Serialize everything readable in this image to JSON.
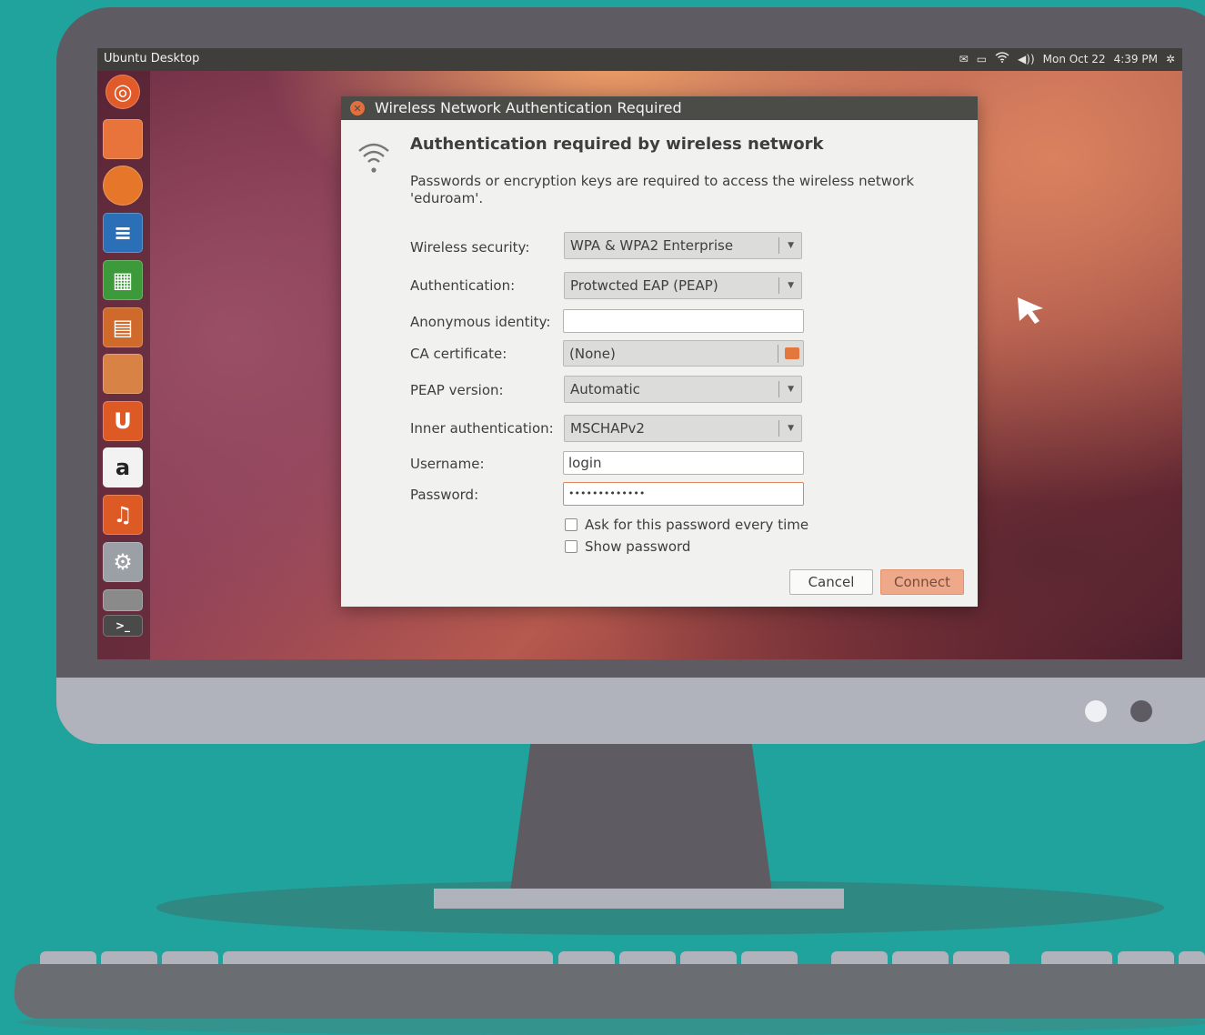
{
  "topbar": {
    "title": "Ubuntu Desktop",
    "date": "Mon Oct 22",
    "time": "4:39 PM",
    "tray_icons": [
      "mail-icon",
      "battery-icon",
      "wifi-icon",
      "volume-icon",
      "settings-gear-icon"
    ]
  },
  "launcher": {
    "items": [
      {
        "name": "ubuntu-dash-icon",
        "color": "#e05a2a"
      },
      {
        "name": "files-folder-icon",
        "color": "#e8743b"
      },
      {
        "name": "firefox-icon",
        "color": "#e6762a"
      },
      {
        "name": "libreoffice-writer-icon",
        "color": "#2b6fb6"
      },
      {
        "name": "libreoffice-calc-icon",
        "color": "#3d9a3a"
      },
      {
        "name": "libreoffice-impress-icon",
        "color": "#d06a2a"
      },
      {
        "name": "software-center-icon",
        "color": "#d88345"
      },
      {
        "name": "ubuntu-one-icon",
        "color": "#dd5a24"
      },
      {
        "name": "amazon-icon",
        "color": "#f2f2f2"
      },
      {
        "name": "ubuntu-one-music-icon",
        "color": "#dd5a24"
      },
      {
        "name": "system-settings-icon",
        "color": "#9aa0a6"
      },
      {
        "name": "workspace-switcher-icon",
        "color": "#8a8a8a"
      },
      {
        "name": "terminal-icon",
        "color": "#4a4a4a"
      }
    ]
  },
  "dialog": {
    "title": "Wireless Network Authentication Required",
    "heading": "Authentication required by wireless network",
    "message": "Passwords or encryption keys are required to access the wireless network 'eduroam'.",
    "fields": {
      "wireless_security": {
        "label": "Wireless security:",
        "value": "WPA & WPA2 Enterprise"
      },
      "authentication": {
        "label": "Authentication:",
        "value": "Protwcted EAP (PEAP)"
      },
      "anonymous_identity": {
        "label": "Anonymous identity:",
        "value": ""
      },
      "ca_certificate": {
        "label": "CA certificate:",
        "value": "(None)"
      },
      "peap_version": {
        "label": "PEAP version:",
        "value": "Automatic"
      },
      "inner_authentication": {
        "label": "Inner authentication:",
        "value": "MSCHAPv2"
      },
      "username": {
        "label": "Username:",
        "value": "login"
      },
      "password": {
        "label": "Password:",
        "value": "•••••••••••••"
      }
    },
    "checkboxes": {
      "ask_password": {
        "label": "Ask for this password every time",
        "checked": false
      },
      "show_password": {
        "label": "Show password",
        "checked": false
      }
    },
    "buttons": {
      "cancel": "Cancel",
      "connect": "Connect"
    }
  },
  "colors": {
    "background": "#1fa39c",
    "accent": "#e46f3e",
    "connect_button": "#eea88a"
  }
}
